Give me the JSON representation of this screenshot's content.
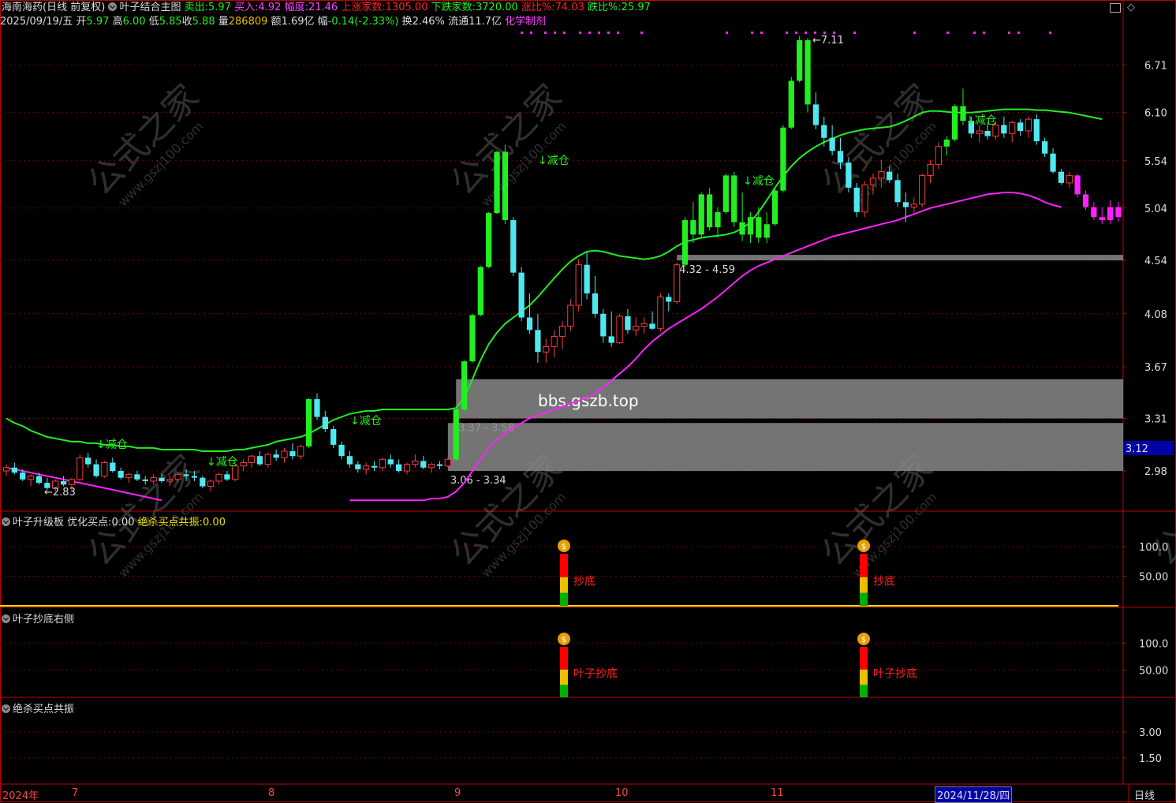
{
  "header": {
    "stock_name": "海南海药",
    "period_mode": "(日线 前复权)",
    "formula_name": "叶子结合主图",
    "sell_label": "卖出:",
    "sell_value": "5.97",
    "buy_label": "买入:",
    "buy_value": "4.92",
    "amp_label": "幅度:",
    "amp_value": "21.46",
    "up_label": "上涨家数:",
    "up_value": "1305.00",
    "down_label": "下跌家数:",
    "down_value": "3720.00",
    "uppct_label": "涨比%:",
    "uppct_value": "74.03",
    "downpct_label": "跌比%:",
    "downpct_value": "25.97",
    "date": "2025/09/19/五",
    "open_label": "开",
    "open_value": "5.97",
    "high_label": "高",
    "high_value": "6.00",
    "low_label": "低",
    "low_value": "5.85",
    "close_label": "收",
    "close_value": "5.88",
    "vol_label": "量",
    "vol_value": "286809",
    "amt_label": "额",
    "amt_value": "1.69亿",
    "chg_label": "幅",
    "chg_value": "-0.14(-2.33%)",
    "turn_label": "换",
    "turn_value": "2.46%",
    "float_label": "流通",
    "float_value": "11.7亿",
    "sector": "化学制剂"
  },
  "colors": {
    "up": "#ff3b3b",
    "down": "#50e8f0",
    "bull": "#22ee22",
    "ma_green": "#22ee22",
    "ma_magenta": "#ff22ff",
    "grid": "#7a0000",
    "border": "#c00000",
    "zone": "#888888"
  },
  "main_axis": {
    "ticks": [
      "6.71",
      "6.10",
      "5.54",
      "5.04",
      "4.54",
      "4.08",
      "3.67",
      "3.31",
      "2.98"
    ],
    "current_price": "3.12"
  },
  "annotations": {
    "reduce": "↓减仓",
    "high_mark": "7.11",
    "low_mark": "2.83",
    "zone1": "4.32 - 4.59",
    "zone2": "3.37 - 3.58",
    "zone3": "3.06 - 3.34",
    "watermark_url": "bbs.gszb.top",
    "watermark_logo": "公式之家",
    "watermark_site": "www.gszj100.com"
  },
  "panel1": {
    "title": "叶子升级板",
    "opt_label": "优化买点:",
    "opt_value": "0.00",
    "res_label": "绝杀买点共振:",
    "res_value": "0.00",
    "ticks": [
      "100.0",
      "50.00"
    ],
    "signal": "抄底"
  },
  "panel2": {
    "title": "叶子抄底右侧",
    "ticks": [
      "100.0",
      "50.00"
    ],
    "signal": "叶子抄底"
  },
  "panel3": {
    "title": "绝杀买点共振",
    "ticks": [
      "3.00",
      "1.50"
    ]
  },
  "time_axis": {
    "labels": [
      "2024年",
      "7",
      "8",
      "9",
      "10",
      "11"
    ],
    "cursor_date": "2024/11/28/四",
    "period": "日线"
  },
  "chart_data": {
    "type": "candlestick",
    "y_range": [
      2.75,
      7.15
    ],
    "candles": [
      [
        2.98,
        3.02,
        2.95,
        3.0
      ],
      [
        3.0,
        3.03,
        2.96,
        2.97
      ],
      [
        2.97,
        2.99,
        2.92,
        2.93
      ],
      [
        2.93,
        2.96,
        2.89,
        2.95
      ],
      [
        2.95,
        2.97,
        2.9,
        2.91
      ],
      [
        2.91,
        2.94,
        2.87,
        2.88
      ],
      [
        2.88,
        2.93,
        2.86,
        2.92
      ],
      [
        2.92,
        2.95,
        2.89,
        2.9
      ],
      [
        2.9,
        2.94,
        2.87,
        2.93
      ],
      [
        2.93,
        3.08,
        2.92,
        3.06
      ],
      [
        3.06,
        3.09,
        3.0,
        3.02
      ],
      [
        3.02,
        3.05,
        2.94,
        2.95
      ],
      [
        2.95,
        3.04,
        2.94,
        3.03
      ],
      [
        3.03,
        3.06,
        2.97,
        2.98
      ],
      [
        2.98,
        3.0,
        2.93,
        2.94
      ],
      [
        2.94,
        2.97,
        2.91,
        2.96
      ],
      [
        2.96,
        2.98,
        2.92,
        2.93
      ],
      [
        2.93,
        2.95,
        2.9,
        2.92
      ],
      [
        2.92,
        2.96,
        2.9,
        2.94
      ],
      [
        2.94,
        2.96,
        2.91,
        2.92
      ],
      [
        2.92,
        2.95,
        2.89,
        2.93
      ],
      [
        2.93,
        2.97,
        2.91,
        2.96
      ],
      [
        2.96,
        2.99,
        2.92,
        2.95
      ],
      [
        2.95,
        2.98,
        2.92,
        2.94
      ],
      [
        2.94,
        2.95,
        2.88,
        2.89
      ],
      [
        2.89,
        2.93,
        2.86,
        2.92
      ],
      [
        2.92,
        2.97,
        2.9,
        2.96
      ],
      [
        2.96,
        2.98,
        2.92,
        2.93
      ],
      [
        2.93,
        3.02,
        2.92,
        3.01
      ],
      [
        3.01,
        3.05,
        2.98,
        3.03
      ],
      [
        3.03,
        3.08,
        3.0,
        3.07
      ],
      [
        3.07,
        3.1,
        3.01,
        3.02
      ],
      [
        3.02,
        3.09,
        3.0,
        3.08
      ],
      [
        3.08,
        3.11,
        3.04,
        3.06
      ],
      [
        3.06,
        3.12,
        3.03,
        3.1
      ],
      [
        3.1,
        3.15,
        3.05,
        3.07
      ],
      [
        3.07,
        3.14,
        3.05,
        3.13
      ],
      [
        3.13,
        3.45,
        3.12,
        3.44
      ],
      [
        3.44,
        3.48,
        3.3,
        3.32
      ],
      [
        3.32,
        3.36,
        3.22,
        3.24
      ],
      [
        3.24,
        3.26,
        3.12,
        3.14
      ],
      [
        3.14,
        3.16,
        3.05,
        3.07
      ],
      [
        3.07,
        3.1,
        3.0,
        3.02
      ],
      [
        3.02,
        3.04,
        2.97,
        2.99
      ],
      [
        2.99,
        3.03,
        2.96,
        3.01
      ],
      [
        3.01,
        3.04,
        2.98,
        3.0
      ],
      [
        3.0,
        3.06,
        2.98,
        3.05
      ],
      [
        3.05,
        3.08,
        3.0,
        3.02
      ],
      [
        3.02,
        3.05,
        2.97,
        2.98
      ],
      [
        2.98,
        3.03,
        2.96,
        3.02
      ],
      [
        3.02,
        3.08,
        3.0,
        3.04
      ],
      [
        3.04,
        3.07,
        2.99,
        3.0
      ],
      [
        3.0,
        3.03,
        2.97,
        3.02
      ],
      [
        3.02,
        3.04,
        2.99,
        3.01
      ],
      [
        3.01,
        3.06,
        3.0,
        3.05
      ],
      [
        3.05,
        3.38,
        3.04,
        3.37
      ],
      [
        3.37,
        3.72,
        3.36,
        3.71
      ],
      [
        3.71,
        4.08,
        3.7,
        4.07
      ],
      [
        4.07,
        4.49,
        4.06,
        4.48
      ],
      [
        4.48,
        5.0,
        4.47,
        4.99
      ],
      [
        4.99,
        5.65,
        4.98,
        5.64
      ],
      [
        5.64,
        5.72,
        4.88,
        4.92
      ],
      [
        4.92,
        4.95,
        4.4,
        4.43
      ],
      [
        4.43,
        4.48,
        4.02,
        4.05
      ],
      [
        4.05,
        4.25,
        3.92,
        3.95
      ],
      [
        3.95,
        4.08,
        3.7,
        3.78
      ],
      [
        3.78,
        3.88,
        3.7,
        3.82
      ],
      [
        3.82,
        3.95,
        3.74,
        3.9
      ],
      [
        3.9,
        4.02,
        3.8,
        3.98
      ],
      [
        3.98,
        4.2,
        3.94,
        4.15
      ],
      [
        4.15,
        4.55,
        4.1,
        4.5
      ],
      [
        4.5,
        4.62,
        4.2,
        4.25
      ],
      [
        4.25,
        4.4,
        4.05,
        4.08
      ],
      [
        4.08,
        4.12,
        3.85,
        3.9
      ],
      [
        3.9,
        4.1,
        3.82,
        3.85
      ],
      [
        3.85,
        4.08,
        3.84,
        4.06
      ],
      [
        4.06,
        4.12,
        3.92,
        3.95
      ],
      [
        3.95,
        4.05,
        3.9,
        3.98
      ],
      [
        3.98,
        4.05,
        3.92,
        4.0
      ],
      [
        4.0,
        4.1,
        3.95,
        3.96
      ],
      [
        3.96,
        4.25,
        3.94,
        4.22
      ],
      [
        4.22,
        4.25,
        4.1,
        4.18
      ],
      [
        4.18,
        4.52,
        4.16,
        4.5
      ],
      [
        4.5,
        4.95,
        4.48,
        4.92
      ],
      [
        4.92,
        5.1,
        4.7,
        4.78
      ],
      [
        4.78,
        5.2,
        4.75,
        5.18
      ],
      [
        5.18,
        5.25,
        4.82,
        4.85
      ],
      [
        4.85,
        5.05,
        4.75,
        5.0
      ],
      [
        5.0,
        5.4,
        4.98,
        5.38
      ],
      [
        5.38,
        5.42,
        4.85,
        4.9
      ],
      [
        4.9,
        5.2,
        4.72,
        4.78
      ],
      [
        4.78,
        5.0,
        4.7,
        4.95
      ],
      [
        4.95,
        5.05,
        4.7,
        4.75
      ],
      [
        4.75,
        5.0,
        4.7,
        4.88
      ],
      [
        4.88,
        5.25,
        4.86,
        5.22
      ],
      [
        5.22,
        5.95,
        5.2,
        5.92
      ],
      [
        5.92,
        6.55,
        5.9,
        6.5
      ],
      [
        6.5,
        7.11,
        6.48,
        7.05
      ],
      [
        7.05,
        7.08,
        6.1,
        6.2
      ],
      [
        6.2,
        6.35,
        5.9,
        5.95
      ],
      [
        5.95,
        6.05,
        5.7,
        5.8
      ],
      [
        5.8,
        5.95,
        5.6,
        5.65
      ],
      [
        5.65,
        5.8,
        5.45,
        5.52
      ],
      [
        5.52,
        5.58,
        5.2,
        5.25
      ],
      [
        5.25,
        5.3,
        4.95,
        5.0
      ],
      [
        5.0,
        5.32,
        4.95,
        5.28
      ],
      [
        5.28,
        5.4,
        5.18,
        5.35
      ],
      [
        5.35,
        5.55,
        5.25,
        5.42
      ],
      [
        5.42,
        5.48,
        5.3,
        5.33
      ],
      [
        5.33,
        5.4,
        5.05,
        5.1
      ],
      [
        5.1,
        5.2,
        4.9,
        5.05
      ],
      [
        5.05,
        5.15,
        4.98,
        5.08
      ],
      [
        5.08,
        5.4,
        5.05,
        5.38
      ],
      [
        5.38,
        5.55,
        5.3,
        5.5
      ],
      [
        5.5,
        5.75,
        5.45,
        5.7
      ],
      [
        5.7,
        5.82,
        5.6,
        5.78
      ],
      [
        5.78,
        6.2,
        5.76,
        6.18
      ],
      [
        6.18,
        6.4,
        5.95,
        6.0
      ],
      [
        6.0,
        6.05,
        5.8,
        5.85
      ],
      [
        5.85,
        5.95,
        5.75,
        5.88
      ],
      [
        5.88,
        5.98,
        5.78,
        5.82
      ],
      [
        5.82,
        6.0,
        5.78,
        5.95
      ],
      [
        5.95,
        6.05,
        5.8,
        5.85
      ],
      [
        5.85,
        6.0,
        5.75,
        5.98
      ],
      [
        5.98,
        6.02,
        5.82,
        5.88
      ],
      [
        5.88,
        6.05,
        5.8,
        6.02
      ],
      [
        6.02,
        6.08,
        5.72,
        5.76
      ],
      [
        5.76,
        5.8,
        5.58,
        5.62
      ],
      [
        5.62,
        5.68,
        5.4,
        5.42
      ],
      [
        5.42,
        5.45,
        5.28,
        5.3
      ],
      [
        5.3,
        5.42,
        5.25,
        5.38
      ],
      [
        5.38,
        5.4,
        5.15,
        5.18
      ],
      [
        5.18,
        5.22,
        5.02,
        5.05
      ],
      [
        5.05,
        5.1,
        4.92,
        4.95
      ],
      [
        4.95,
        5.05,
        4.88,
        4.92
      ],
      [
        4.92,
        5.12,
        4.88,
        5.05
      ],
      [
        5.05,
        5.1,
        4.9,
        4.95
      ]
    ],
    "ma_green": [
      3.31,
      3.28,
      3.26,
      3.23,
      3.21,
      3.19,
      3.18,
      3.17,
      3.16,
      3.16,
      3.15,
      3.15,
      3.14,
      3.14,
      3.13,
      3.13,
      3.12,
      3.12,
      3.12,
      3.11,
      3.11,
      3.11,
      3.11,
      3.11,
      3.1,
      3.1,
      3.1,
      3.1,
      3.11,
      3.11,
      3.12,
      3.13,
      3.14,
      3.16,
      3.17,
      3.18,
      3.19,
      3.21,
      3.24,
      3.27,
      3.3,
      3.32,
      3.34,
      3.35,
      3.36,
      3.36,
      3.37,
      3.37,
      3.37,
      3.37,
      3.37,
      3.37,
      3.37,
      3.37,
      3.37,
      3.38,
      3.45,
      3.58,
      3.72,
      3.84,
      3.93,
      4.0,
      4.05,
      4.1,
      4.15,
      4.22,
      4.3,
      4.38,
      4.46,
      4.53,
      4.58,
      4.62,
      4.63,
      4.62,
      4.6,
      4.58,
      4.57,
      4.56,
      4.55,
      4.56,
      4.58,
      4.62,
      4.67,
      4.71,
      4.73,
      4.75,
      4.76,
      4.77,
      4.78,
      4.8,
      4.84,
      4.9,
      5.0,
      5.12,
      5.25,
      5.37,
      5.48,
      5.57,
      5.64,
      5.7,
      5.75,
      5.79,
      5.83,
      5.86,
      5.88,
      5.9,
      5.91,
      5.92,
      5.93,
      5.96,
      6.0,
      6.05,
      6.1,
      6.12,
      6.12,
      6.11,
      6.1,
      6.1,
      6.1,
      6.11,
      6.12,
      6.13,
      6.14,
      6.14,
      6.14,
      6.14,
      6.13,
      6.13,
      6.12,
      6.11,
      6.1,
      6.08,
      6.06,
      6.04,
      6.02
    ],
    "ma_magenta": [
      3.0,
      2.99,
      2.98,
      2.97,
      2.96,
      2.95,
      2.94,
      2.93,
      2.92,
      2.91,
      2.9,
      2.89,
      2.88,
      2.87,
      2.86,
      2.85,
      2.84,
      2.83,
      2.82,
      2.81,
      null,
      null,
      null,
      null,
      null,
      null,
      null,
      null,
      null,
      null,
      null,
      null,
      null,
      null,
      null,
      null,
      null,
      null,
      null,
      null,
      null,
      null,
      2.81,
      2.81,
      2.81,
      2.81,
      2.81,
      2.81,
      2.81,
      2.81,
      2.81,
      2.81,
      2.82,
      2.82,
      2.83,
      2.86,
      2.91,
      2.98,
      3.05,
      3.12,
      3.17,
      3.21,
      3.25,
      3.28,
      3.31,
      3.33,
      3.35,
      3.37,
      3.39,
      3.41,
      3.43,
      3.45,
      3.48,
      3.52,
      3.57,
      3.62,
      3.67,
      3.73,
      3.8,
      3.86,
      3.91,
      3.96,
      4.0,
      4.04,
      4.08,
      4.12,
      4.17,
      4.22,
      4.28,
      4.34,
      4.4,
      4.45,
      4.49,
      4.52,
      4.55,
      4.58,
      4.61,
      4.64,
      4.67,
      4.7,
      4.73,
      4.76,
      4.78,
      4.8,
      4.82,
      4.84,
      4.86,
      4.88,
      4.9,
      4.92,
      4.95,
      4.98,
      5.01,
      5.04,
      5.06,
      5.08,
      5.1,
      5.12,
      5.14,
      5.16,
      5.18,
      5.19,
      5.2,
      5.2,
      5.19,
      5.17,
      5.14,
      5.1,
      5.07,
      5.05
    ]
  }
}
